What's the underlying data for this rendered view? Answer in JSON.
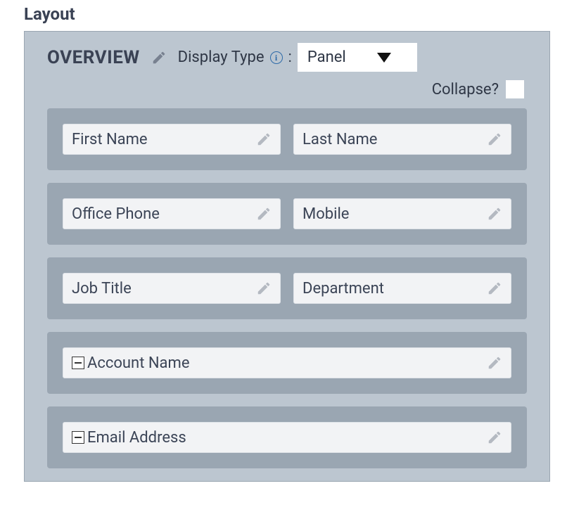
{
  "title": "Layout",
  "section": {
    "name": "OVERVIEW",
    "display_type_label": "Display Type",
    "display_type_value": "Panel",
    "collapse_label": "Collapse?"
  },
  "rows": [
    {
      "cols": [
        {
          "label": "First Name"
        },
        {
          "label": "Last Name"
        }
      ]
    },
    {
      "cols": [
        {
          "label": "Office Phone"
        },
        {
          "label": "Mobile"
        }
      ]
    },
    {
      "cols": [
        {
          "label": "Job Title"
        },
        {
          "label": "Department"
        }
      ]
    },
    {
      "cols": [
        {
          "label": "Account Name",
          "full": true,
          "box": true
        }
      ]
    },
    {
      "cols": [
        {
          "label": "Email Address",
          "full": true,
          "box": true
        }
      ]
    }
  ]
}
